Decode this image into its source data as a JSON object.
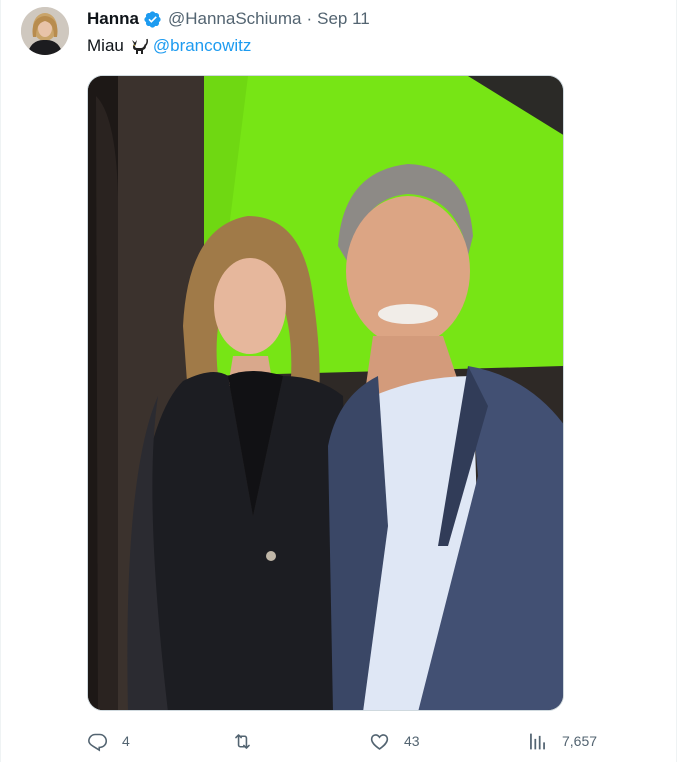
{
  "tweet": {
    "author_name": "Hanna",
    "author_handle": "@HannaSchiuma",
    "separator": "·",
    "date": "Sep 11",
    "text": "Miau",
    "mention": "@brancowitz",
    "verified": true,
    "accent_color": "#1d9bf0"
  },
  "actions": {
    "reply_count": "4",
    "retweet_count": "",
    "like_count": "43",
    "views_count": "7,657"
  },
  "icons": {
    "verified": "verified-badge-icon",
    "cat": "black-cat-emoji",
    "reply": "reply-icon",
    "retweet": "retweet-icon",
    "like": "heart-icon",
    "views": "views-chart-icon"
  }
}
